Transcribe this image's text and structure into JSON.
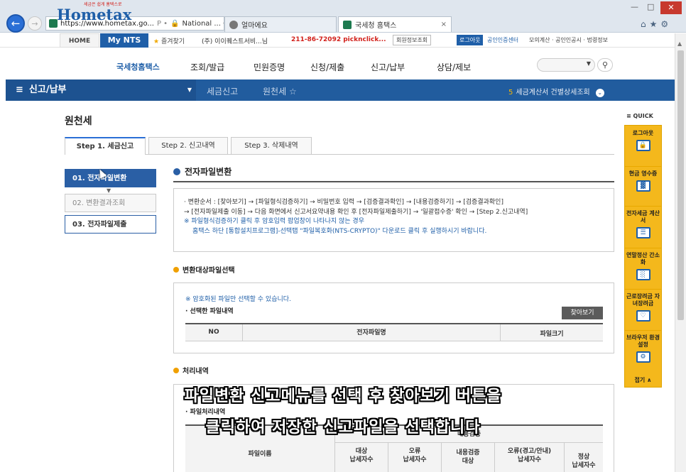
{
  "browser": {
    "url": "https://www.hometax.go...",
    "addr_sep": "Ρ •",
    "addr_cert": "National ... C",
    "tabs": [
      {
        "label": "얼마에요"
      },
      {
        "label": "국세청 홈택스",
        "close": "×"
      }
    ],
    "controls": {
      "min": "—",
      "max": "□",
      "close": "✕"
    },
    "toolbar_icons": "⌂★⚙"
  },
  "utilbar": {
    "home": "HOME",
    "my_nts": "My NTS",
    "favorites": "즐겨찾기",
    "user": "(주) 이이퀘스트서비...님",
    "phone": "211-86-72092 picknclick...",
    "member": "회원정보조회",
    "logout": "로그아웃",
    "cert": "공인인증센터",
    "mock": "모의계산 · 공인인공시 · 법령정보"
  },
  "logo": {
    "text": "Hometax",
    "tagline": "세금은 쉽게 홈택스로",
    "kr": "국세청홈택스"
  },
  "gnb": [
    "조회/발급",
    "민원증명",
    "신청/제출",
    "신고/납부",
    "상담/제보"
  ],
  "bluebar": {
    "title": "신고/납부",
    "crumb1": "세금신고",
    "crumb2": "원천세",
    "right_num": "5",
    "right_text": "세금계산서 건별상세조회"
  },
  "page": {
    "title": "원천세",
    "steps": [
      "Step 1. 세금신고",
      "Step 2. 신고내역",
      "Step 3. 삭제내역"
    ],
    "side_menu": [
      "01. 전자파일변환",
      "02. 변환결과조회",
      "03. 전자파일제출"
    ],
    "section_title": "전자파일변환",
    "info": {
      "line1": "· 변환순서 : [찾아보기] → [파일형식검증하기] → 비밀번호 입력 → [검증결과확인] → [내용검증하기] → [검증결과확인]",
      "line2": "→ [전자파일제출 이동] → 다음 화면에서 신고서요약내용 확인 후 [전자파일제출하기] → '일괄접수증' 확인 → [Step 2.신고내역]",
      "line3": "※ 파일형식검증하기 클릭 후 암호입력 팝업창이 나타나지 않는 경우",
      "line4": "홈택스 하단 [통합설치프로그램]-선택탭 \"파일복호화(NTS-CRYPTO)\" 다운로드 클릭 후 실행하시기 바랍니다."
    },
    "file_section": {
      "title": "변환대상파일선택",
      "note": "※ 암호화된 파일만 선택할 수 있습니다.",
      "label": "· 선택한 파일내역",
      "find_button": "찾아보기",
      "columns": [
        "NO",
        "전자파일명",
        "파일크기"
      ]
    },
    "process_section": {
      "title": "처리내역",
      "label": "· 파일처리내역",
      "col_name": "파일이름",
      "col_group": "내용검증",
      "col_a1": "대상",
      "col_a2": "납세자수",
      "col_b1": "오류",
      "col_b2": "납세자수",
      "col_c1": "내용검증",
      "col_c2": "대상",
      "col_d1": "오류(경고/안내)",
      "col_d2": "납세자수",
      "col_e1": "정상",
      "col_e2": "납세자수"
    }
  },
  "quick": {
    "head": "≡ QUICK",
    "items": [
      {
        "label": "로그아웃",
        "icon": "lock-icon",
        "glyph": "🔒"
      },
      {
        "label": "현금 영수증",
        "icon": "receipt-icon",
        "glyph": "▓"
      },
      {
        "label": "전자세금 계산서",
        "icon": "invoice-icon",
        "glyph": "☰"
      },
      {
        "label": "연말정산 간소화",
        "icon": "calculator-icon",
        "glyph": "░"
      },
      {
        "label": "근로장려금 자녀장려금",
        "icon": "heart-icon",
        "glyph": "♡"
      },
      {
        "label": "브라우저 환경설정",
        "icon": "gear-icon",
        "glyph": "⚙"
      }
    ],
    "fold": "접기 ∧"
  },
  "captions": {
    "line1": "파일변환 신고메뉴를 선택 후 찾아보기 버튼을",
    "line2": "클릭하여 저장한 신고파일을 선택합니다"
  }
}
